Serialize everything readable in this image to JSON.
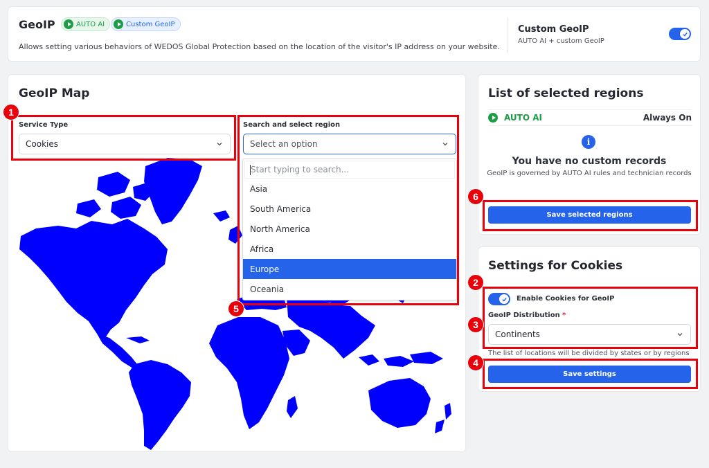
{
  "header": {
    "title": "GeoIP",
    "badges": {
      "auto_ai": "AUTO AI",
      "custom_geoip": "Custom GeoIP"
    },
    "description": "Allows setting various behaviors of WEDOS Global Protection based on the location of the visitor's IP address on your website.",
    "custom_geoip_title": "Custom GeoIP",
    "custom_geoip_subtitle": "AUTO AI + custom GeoIP",
    "toggle_on": true
  },
  "map_card": {
    "title": "GeoIP Map",
    "service_type": {
      "label": "Service Type",
      "value": "Cookies"
    },
    "region": {
      "label": "Search and select region",
      "placeholder": "Select an option",
      "search_placeholder": "Start typing to search...",
      "options": [
        "Asia",
        "South America",
        "North America",
        "Africa",
        "Europe",
        "Oceania"
      ],
      "highlighted": "Europe"
    }
  },
  "regions_card": {
    "title": "List of selected regions",
    "auto_row": {
      "label": "AUTO AI",
      "status": "Always On"
    },
    "empty_title": "You have no custom records",
    "empty_subtitle": "GeoIP is governed by AUTO AI rules and technician records",
    "save_button": "Save selected regions"
  },
  "settings_card": {
    "title": "Settings for Cookies",
    "toggle_label": "Enable Cookies for GeoIP",
    "distribution": {
      "label": "GeoIP Distribution",
      "required_mark": "*",
      "value": "Continents"
    },
    "help_text": "The list of locations will be divided by states or by regions",
    "save_button": "Save settings"
  },
  "annotations": [
    "1",
    "2",
    "3",
    "4",
    "5",
    "6"
  ],
  "colors": {
    "accent": "#2563eb",
    "map_fill": "#0000ff",
    "annotation": "#e8000b",
    "success": "#1e9c48"
  }
}
